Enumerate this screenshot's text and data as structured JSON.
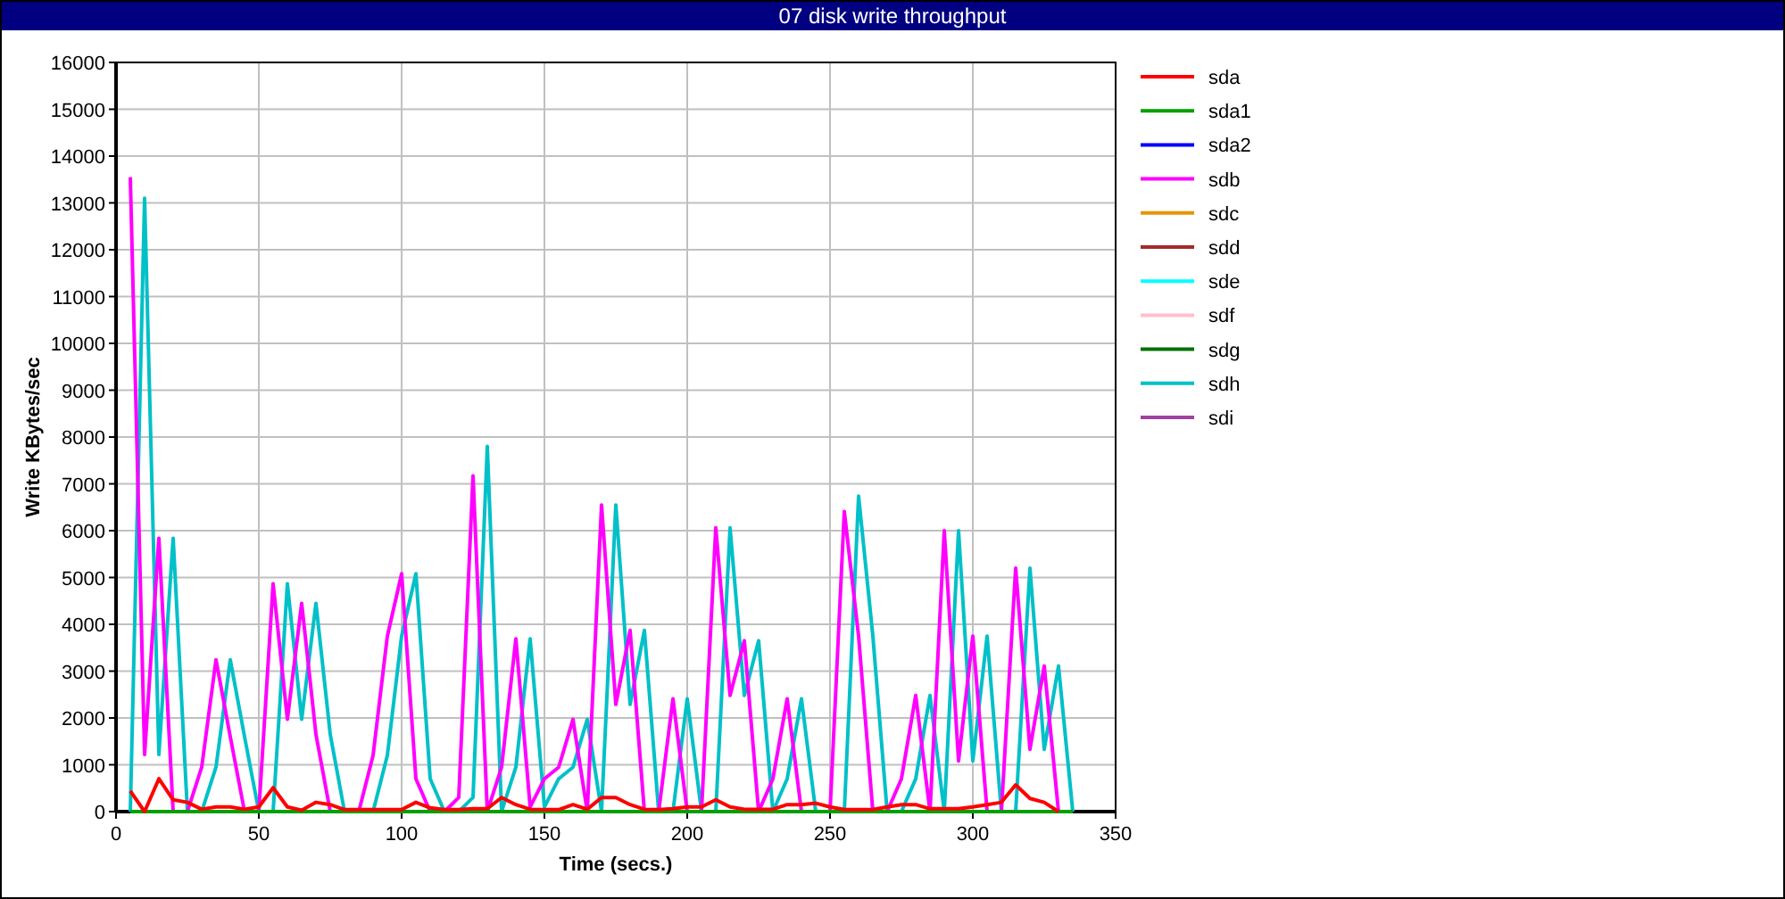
{
  "chart_data": {
    "type": "line",
    "title": "07 disk write throughput",
    "xlabel": "Time (secs.)",
    "ylabel": "Write KBytes/sec",
    "xlim": [
      0,
      350
    ],
    "ylim": [
      0,
      16000
    ],
    "grid": true,
    "legend": true,
    "xticks": [
      0,
      50,
      100,
      150,
      200,
      250,
      300,
      350
    ],
    "yticks": [
      0,
      1000,
      2000,
      3000,
      4000,
      5000,
      6000,
      7000,
      8000,
      9000,
      10000,
      11000,
      12000,
      13000,
      14000,
      15000,
      16000
    ],
    "x": [
      5,
      10,
      15,
      20,
      25,
      30,
      35,
      40,
      45,
      50,
      55,
      60,
      65,
      70,
      75,
      80,
      85,
      90,
      95,
      100,
      105,
      110,
      115,
      120,
      125,
      130,
      135,
      140,
      145,
      150,
      155,
      160,
      165,
      170,
      175,
      180,
      185,
      190,
      195,
      200,
      205,
      210,
      215,
      220,
      225,
      230,
      235,
      240,
      245,
      250,
      255,
      260,
      265,
      270,
      275,
      280,
      285,
      290,
      295,
      300,
      305,
      310,
      315,
      320,
      325,
      330,
      335
    ],
    "series": [
      {
        "name": "sda",
        "color": "#ff0000",
        "values": [
          440,
          0,
          700,
          250,
          200,
          50,
          100,
          100,
          50,
          100,
          510,
          100,
          30,
          200,
          150,
          40,
          40,
          40,
          40,
          40,
          200,
          80,
          40,
          40,
          60,
          60,
          300,
          150,
          50,
          40,
          40,
          150,
          50,
          300,
          300,
          150,
          50,
          40,
          60,
          100,
          100,
          250,
          100,
          50,
          50,
          50,
          150,
          150,
          180,
          100,
          40,
          40,
          40,
          100,
          150,
          150,
          60,
          60,
          60,
          100,
          150,
          200,
          570,
          280,
          200,
          0,
          null
        ]
      },
      {
        "name": "sda1",
        "color": "#00a000",
        "values": [
          0,
          0,
          0,
          0,
          0,
          0,
          0,
          0,
          0,
          0,
          0,
          0,
          0,
          0,
          0,
          0,
          0,
          0,
          0,
          0,
          0,
          0,
          0,
          0,
          0,
          0,
          0,
          0,
          0,
          0,
          0,
          0,
          0,
          0,
          0,
          0,
          0,
          0,
          0,
          0,
          0,
          0,
          0,
          0,
          0,
          0,
          0,
          0,
          0,
          0,
          0,
          0,
          0,
          0,
          0,
          0,
          0,
          0,
          0,
          0,
          0,
          0,
          0,
          0,
          0,
          0,
          0
        ]
      },
      {
        "name": "sda2",
        "color": "#0000ff",
        "values": [
          null,
          null,
          null,
          null,
          null,
          null,
          null,
          null,
          null,
          null,
          null,
          null,
          null,
          null,
          null,
          null,
          null,
          null,
          null,
          null,
          null,
          null,
          null,
          null,
          null,
          null,
          null,
          null,
          null,
          null,
          null,
          null,
          null,
          null,
          null,
          null,
          null,
          null,
          null,
          null,
          null,
          null,
          null,
          null,
          null,
          null,
          null,
          null,
          null,
          null,
          null,
          null,
          null,
          null,
          null,
          null,
          null,
          null,
          null,
          null,
          null,
          null,
          null,
          null,
          null,
          null,
          null
        ]
      },
      {
        "name": "sdb",
        "color": "#ff00ff",
        "values": [
          13550,
          1220,
          5840,
          0,
          0,
          950,
          3240,
          1600,
          0,
          0,
          4870,
          1970,
          4450,
          1650,
          0,
          0,
          0,
          1200,
          3750,
          5080,
          700,
          0,
          0,
          300,
          7170,
          0,
          950,
          3690,
          100,
          700,
          950,
          1970,
          0,
          6550,
          2290,
          3870,
          0,
          0,
          2410,
          0,
          0,
          6060,
          2480,
          3650,
          0,
          700,
          2410,
          0,
          0,
          0,
          6410,
          3750,
          0,
          0,
          700,
          2480,
          0,
          6000,
          1080,
          3750,
          0,
          0,
          5200,
          1330,
          3110,
          0,
          0
        ]
      },
      {
        "name": "sdc",
        "color": "#e69500",
        "values": [
          null,
          null,
          null,
          null,
          null,
          null,
          null,
          null,
          null,
          null,
          null,
          null,
          null,
          null,
          null,
          null,
          null,
          null,
          null,
          null,
          null,
          null,
          null,
          null,
          null,
          null,
          null,
          null,
          null,
          null,
          null,
          null,
          null,
          null,
          null,
          null,
          null,
          null,
          null,
          null,
          null,
          null,
          null,
          null,
          null,
          null,
          null,
          null,
          null,
          null,
          null,
          null,
          null,
          null,
          null,
          null,
          null,
          null,
          null,
          null,
          null,
          null,
          null,
          null,
          null,
          null,
          null
        ]
      },
      {
        "name": "sdd",
        "color": "#a52a2a",
        "values": [
          null,
          null,
          null,
          null,
          null,
          null,
          null,
          null,
          null,
          null,
          null,
          null,
          null,
          null,
          null,
          null,
          null,
          null,
          null,
          null,
          null,
          null,
          null,
          null,
          null,
          null,
          null,
          null,
          null,
          null,
          null,
          null,
          null,
          null,
          null,
          null,
          null,
          null,
          null,
          null,
          null,
          null,
          null,
          null,
          null,
          null,
          null,
          null,
          null,
          null,
          null,
          null,
          null,
          null,
          null,
          null,
          null,
          null,
          null,
          null,
          null,
          null,
          null,
          null,
          null,
          null,
          null
        ]
      },
      {
        "name": "sde",
        "color": "#00ffff",
        "values": [
          null,
          null,
          null,
          null,
          null,
          null,
          null,
          null,
          null,
          null,
          null,
          null,
          null,
          null,
          null,
          null,
          null,
          null,
          null,
          null,
          null,
          null,
          null,
          null,
          null,
          null,
          null,
          null,
          null,
          null,
          null,
          null,
          null,
          null,
          null,
          null,
          null,
          null,
          null,
          null,
          null,
          null,
          null,
          null,
          null,
          null,
          null,
          null,
          null,
          null,
          null,
          null,
          null,
          null,
          null,
          null,
          null,
          null,
          null,
          null,
          null,
          null,
          null,
          null,
          null,
          null,
          null
        ]
      },
      {
        "name": "sdf",
        "color": "#ffc0cb",
        "values": [
          null,
          null,
          null,
          null,
          null,
          null,
          null,
          null,
          null,
          null,
          null,
          null,
          null,
          null,
          null,
          null,
          null,
          null,
          null,
          null,
          null,
          null,
          null,
          null,
          null,
          null,
          null,
          null,
          null,
          null,
          null,
          null,
          null,
          null,
          null,
          null,
          null,
          null,
          null,
          null,
          null,
          null,
          null,
          null,
          null,
          null,
          null,
          null,
          null,
          null,
          null,
          null,
          null,
          null,
          null,
          null,
          null,
          null,
          null,
          null,
          null,
          null,
          null,
          null,
          null,
          null,
          null
        ]
      },
      {
        "name": "sdg",
        "color": "#007000",
        "values": [
          null,
          null,
          null,
          null,
          null,
          null,
          null,
          null,
          null,
          null,
          null,
          null,
          null,
          null,
          null,
          null,
          null,
          null,
          null,
          null,
          null,
          null,
          null,
          null,
          null,
          null,
          null,
          null,
          null,
          null,
          null,
          null,
          null,
          null,
          null,
          null,
          null,
          null,
          null,
          null,
          null,
          null,
          null,
          null,
          null,
          null,
          null,
          null,
          null,
          null,
          null,
          null,
          null,
          null,
          null,
          null,
          null,
          null,
          null,
          null,
          null,
          null,
          null,
          null,
          null,
          null,
          null
        ]
      },
      {
        "name": "sdh",
        "color": "#00c0c8",
        "values": [
          0,
          13100,
          1220,
          5840,
          0,
          0,
          950,
          3240,
          1600,
          0,
          0,
          4870,
          1970,
          4450,
          1650,
          0,
          0,
          0,
          1200,
          3750,
          5080,
          700,
          0,
          0,
          300,
          7800,
          0,
          950,
          3690,
          100,
          700,
          950,
          1970,
          0,
          6550,
          2290,
          3870,
          0,
          0,
          2410,
          0,
          0,
          6060,
          2480,
          3650,
          0,
          700,
          2410,
          0,
          0,
          0,
          6740,
          3750,
          0,
          0,
          700,
          2480,
          0,
          6000,
          1080,
          3750,
          0,
          0,
          5200,
          1330,
          3110,
          0
        ]
      },
      {
        "name": "sdi",
        "color": "#a040a0",
        "values": [
          null,
          null,
          null,
          null,
          null,
          null,
          null,
          null,
          null,
          null,
          null,
          null,
          null,
          null,
          null,
          null,
          null,
          null,
          null,
          null,
          null,
          null,
          null,
          null,
          null,
          null,
          null,
          null,
          null,
          null,
          null,
          null,
          null,
          null,
          null,
          null,
          null,
          null,
          null,
          null,
          null,
          null,
          null,
          null,
          null,
          null,
          null,
          null,
          null,
          null,
          null,
          null,
          null,
          null,
          null,
          null,
          null,
          null,
          null,
          null,
          null,
          null,
          null,
          null,
          null,
          null,
          null
        ]
      }
    ]
  }
}
